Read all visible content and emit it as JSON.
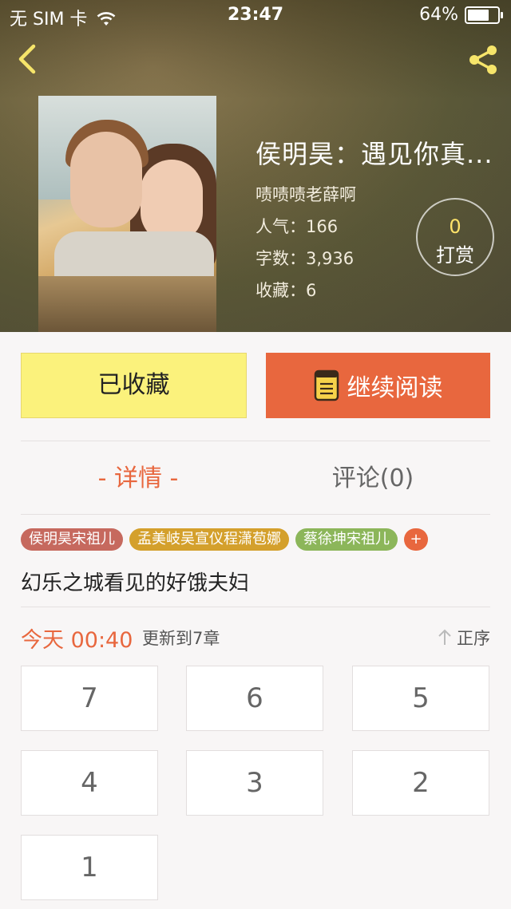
{
  "status_bar": {
    "carrier": "无 SIM 卡",
    "time": "23:47",
    "battery": "64%",
    "battery_level": 0.64
  },
  "book": {
    "title": "侯明昊：遇见你真...",
    "author": "啧啧啧老薛啊",
    "popularity": "人气：166",
    "words": "字数：3,936",
    "favorites": "收藏：6"
  },
  "reward": {
    "count": "0",
    "label": "打赏"
  },
  "actions": {
    "favorited_label": "已收藏",
    "continue_label": "继续阅读"
  },
  "tabs": [
    {
      "label": "- 详情 -"
    },
    {
      "label": "评论(0)"
    }
  ],
  "tags": [
    {
      "label": "侯明昊宋祖儿",
      "color": "#c6695e"
    },
    {
      "label": "孟美岐吴宣仪程潇苞娜",
      "color": "#d4a02c"
    },
    {
      "label": "蔡徐坤宋祖儿",
      "color": "#8cb65a"
    }
  ],
  "tag_add": "+",
  "description": "幻乐之城看见的好饿夫妇",
  "update": {
    "date": "今天 00:40",
    "note": "更新到7章",
    "sort_label": "正序"
  },
  "chapters": [
    "7",
    "6",
    "5",
    "4",
    "3",
    "2",
    "1"
  ],
  "colors": {
    "accent": "#e8673e",
    "favorite_button": "#fbf27c",
    "reward_count": "#ffe36a"
  }
}
